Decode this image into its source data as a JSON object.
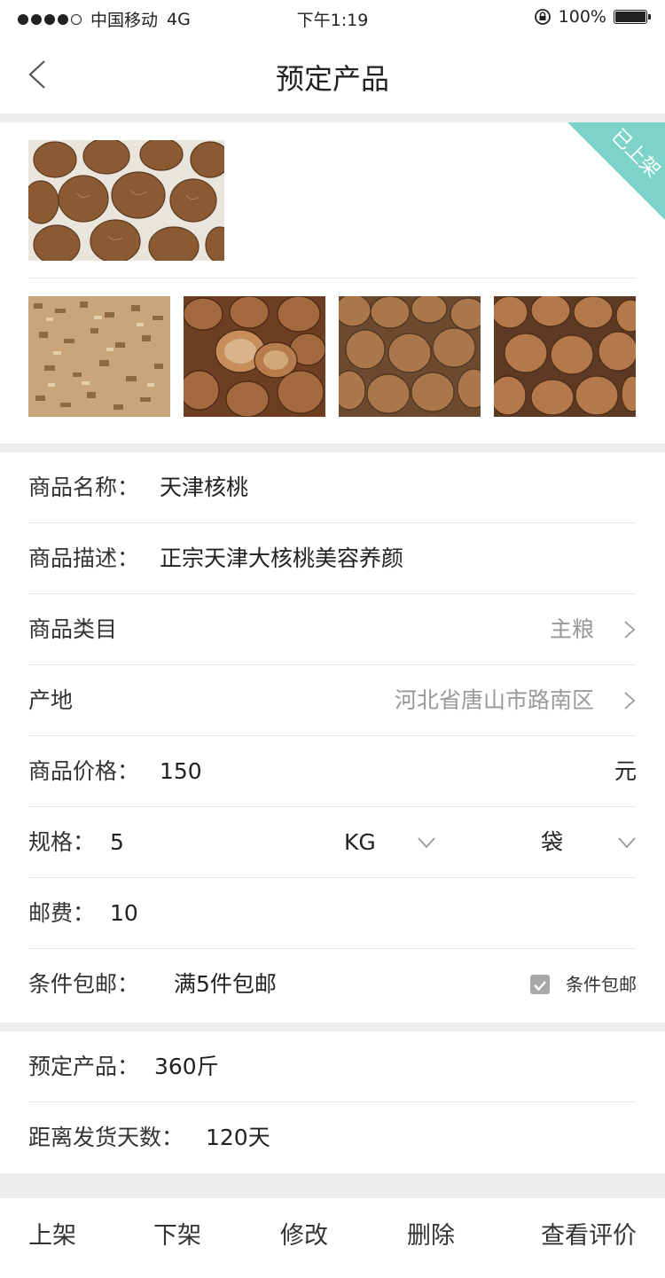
{
  "status_bar": {
    "carrier": "中国移动",
    "network": "4G",
    "time": "下午1:19",
    "battery_percent": "100%",
    "signal_bars": 4
  },
  "nav": {
    "title": "预定产品",
    "back_icon": "chevron-left-icon"
  },
  "gallery": {
    "ribbon_label": "已上架",
    "ribbon_color": "#7dd3c8",
    "main_image": "walnut-photo",
    "thumbnails": [
      "chopped-walnut-kernels-photo",
      "cracked-walnuts-photo",
      "walnuts-pile-photo",
      "walnuts-closeup-photo"
    ]
  },
  "form": {
    "name": {
      "label": "商品名称：",
      "value": "天津核桃"
    },
    "description": {
      "label": "商品描述：",
      "value": "正宗天津大核桃美容养颜"
    },
    "category": {
      "label": "商品类目",
      "value": "主粮"
    },
    "origin": {
      "label": "产地",
      "value": "河北省唐山市路南区"
    },
    "price": {
      "label": "商品价格：",
      "value": "150",
      "unit": "元"
    },
    "spec": {
      "label": "规格：",
      "value": "5",
      "unit": "KG",
      "package": "袋"
    },
    "shipping": {
      "label": "邮费：",
      "value": "10"
    },
    "free_shipping": {
      "label": "条件包邮：",
      "value": "满5件包邮",
      "checkbox_label": "条件包邮",
      "checked": true
    }
  },
  "preorder": {
    "quantity": {
      "label": "预定产品：",
      "value": "360斤"
    },
    "days": {
      "label": "距离发货天数：",
      "value": "120天"
    }
  },
  "actions": {
    "list": "上架",
    "delist": "下架",
    "edit": "修改",
    "delete": "删除",
    "reviews": "查看评价"
  }
}
